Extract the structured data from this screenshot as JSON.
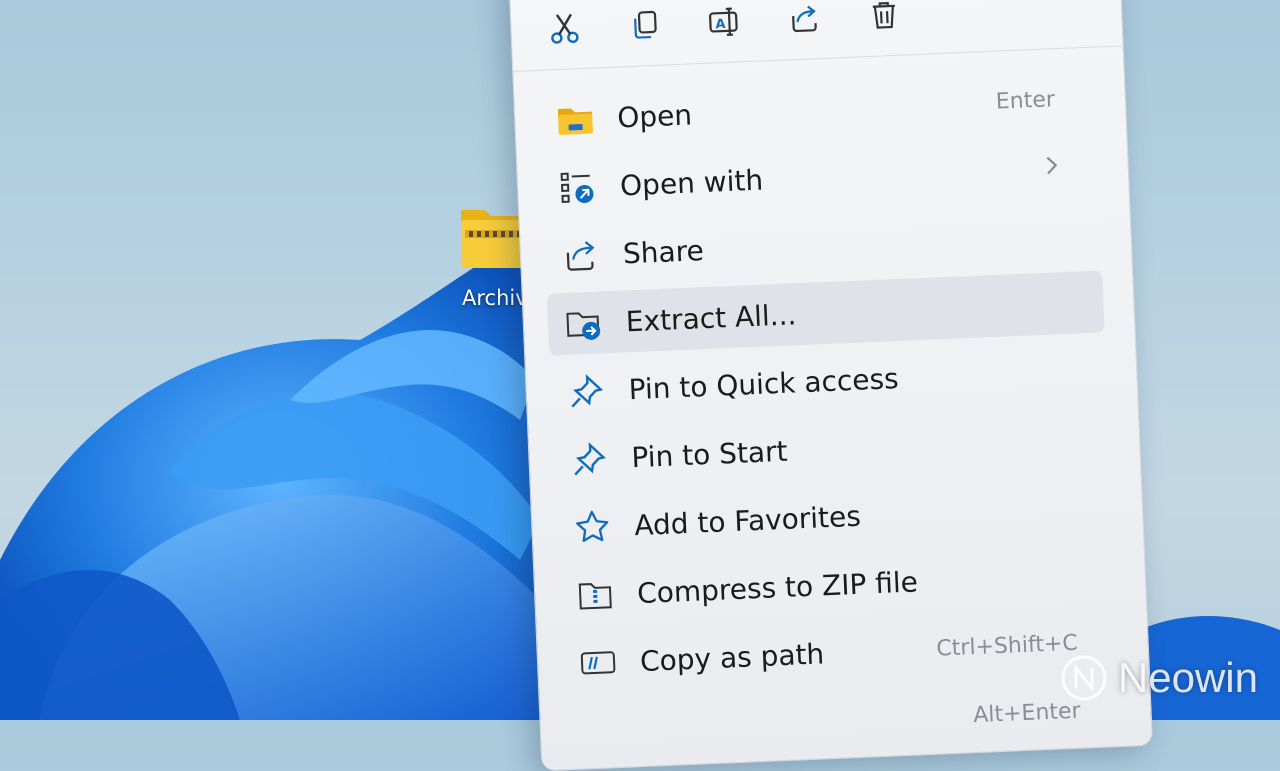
{
  "desktop": {
    "icon_label": "Archive"
  },
  "toolbar": {
    "cut": "scissors-icon",
    "copy": "copy-icon",
    "rename": "rename-icon",
    "share": "share-icon",
    "delete": "trash-icon"
  },
  "menu": {
    "items": [
      {
        "label": "Open",
        "hint": "Enter",
        "icon": "folder-icon"
      },
      {
        "label": "Open with",
        "hint": "",
        "icon": "open-with-icon",
        "submenu": true
      },
      {
        "label": "Share",
        "hint": "",
        "icon": "share-icon"
      },
      {
        "label": "Extract All...",
        "hint": "",
        "icon": "extract-icon",
        "highlighted": true
      },
      {
        "label": "Pin to Quick access",
        "hint": "",
        "icon": "pin-icon"
      },
      {
        "label": "Pin to Start",
        "hint": "",
        "icon": "pin-icon"
      },
      {
        "label": "Add to Favorites",
        "hint": "",
        "icon": "star-icon"
      },
      {
        "label": "Compress to ZIP file",
        "hint": "",
        "icon": "zip-icon"
      },
      {
        "label": "Copy as path",
        "hint": "Ctrl+Shift+C",
        "icon": "path-icon"
      },
      {
        "label": "",
        "hint": "Alt+Enter",
        "icon": ""
      }
    ]
  },
  "watermark": {
    "brand": "Neowin"
  },
  "colors": {
    "accent": "#0f6cbd",
    "folder": "#f5c518",
    "wallpaper_blue": "#1f7be0"
  }
}
